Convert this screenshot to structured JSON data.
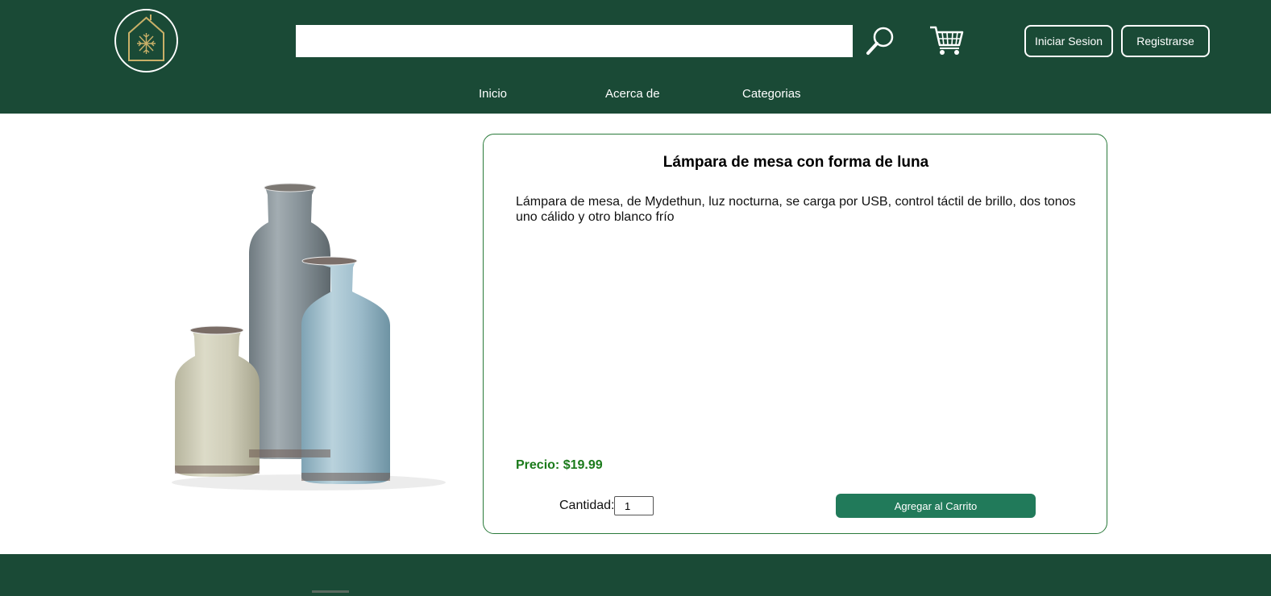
{
  "header": {
    "logo_icon": "house-snowflake-logo-icon",
    "search": {
      "placeholder": "",
      "value": "",
      "icon": "search-icon"
    },
    "cart_icon": "shopping-cart-icon",
    "login_label": "Iniciar Sesion",
    "register_label": "Registrarse",
    "nav": [
      "Inicio",
      "Acerca de",
      "Categorias"
    ]
  },
  "product": {
    "image": "ceramic-vases-image",
    "title": "Lámpara de mesa con forma de luna",
    "description": "Lámpara de mesa, de Mydethun, luz nocturna, se carga por USB, control táctil de brillo, dos tonos uno cálido y otro blanco frío",
    "price_label": "Precio: $19.99",
    "quantity_label": "Cantidad:",
    "quantity_value": "1",
    "add_to_cart_label": "Agregar al Carrito"
  },
  "colors": {
    "header_bg": "#1a4a36",
    "accent_green": "#217a5a",
    "price_green": "#1a7a1a",
    "card_border": "#2a7a3a"
  }
}
